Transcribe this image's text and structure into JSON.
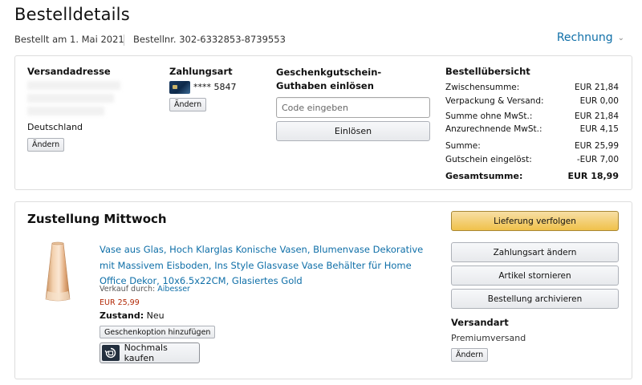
{
  "page": {
    "title": "Bestelldetails",
    "ordered_on": "Bestellt am 1. Mai 2021",
    "order_number": "Bestellnr. 302-6332853-8739553",
    "invoice_label": "Rechnung"
  },
  "shipping_address": {
    "label": "Versandadresse",
    "country": "Deutschland",
    "change_label": "Ändern"
  },
  "payment": {
    "label": "Zahlungsart",
    "card_suffix": "**** 5847",
    "change_label": "Ändern"
  },
  "gift_card": {
    "label": "Geschenkgutschein-Guthaben einlösen",
    "placeholder": "Code eingeben",
    "redeem_label": "Einlösen"
  },
  "summary": {
    "label": "Bestellübersicht",
    "rows": [
      {
        "label": "Zwischensumme:",
        "value": "EUR 21,84"
      },
      {
        "label": "Verpackung & Versand:",
        "value": "EUR 0,00"
      },
      {
        "label": "Summe ohne MwSt.:",
        "value": "EUR 21,84"
      },
      {
        "label": "Anzurechnende MwSt.:",
        "value": "EUR 4,15"
      },
      {
        "label": "Summe:",
        "value": "EUR 25,99"
      },
      {
        "label": "Gutschein eingelöst:",
        "value": "-EUR 7,00"
      }
    ],
    "total_label": "Gesamtsumme:",
    "total_value": "EUR 18,99"
  },
  "delivery": {
    "title": "Zustellung Mittwoch",
    "product_title": "Vase aus Glas, Hoch Klarglas Konische Vasen, Blumenvase Dekorative mit Massivem Eisboden, Ins Style Glasvase Vase Behälter für Home Office Dekor, 10x6.5x22CM, Glasiertes Gold",
    "seller_prefix": "Verkauf durch: ",
    "seller_name": "Aibesser",
    "price": "EUR 25,99",
    "condition_label": "Zustand:",
    "condition_value": "Neu",
    "gift_option_label": "Geschenkoption hinzufügen",
    "buy_again_label": "Nochmals kaufen"
  },
  "actions": {
    "track": "Lieferung verfolgen",
    "change_payment": "Zahlungsart ändern",
    "cancel_items": "Artikel stornieren",
    "archive_order": "Bestellung archivieren"
  },
  "shipping_method": {
    "label": "Versandart",
    "value": "Premiumversand",
    "change_label": "Ändern"
  },
  "colors": {
    "link": "#0f6fa8",
    "price": "#b12704",
    "primary_button": "#f0c14b"
  },
  "icons": [
    "credit-card-icon",
    "chevron-down-icon",
    "buy-again-icon",
    "vase-product-image"
  ]
}
